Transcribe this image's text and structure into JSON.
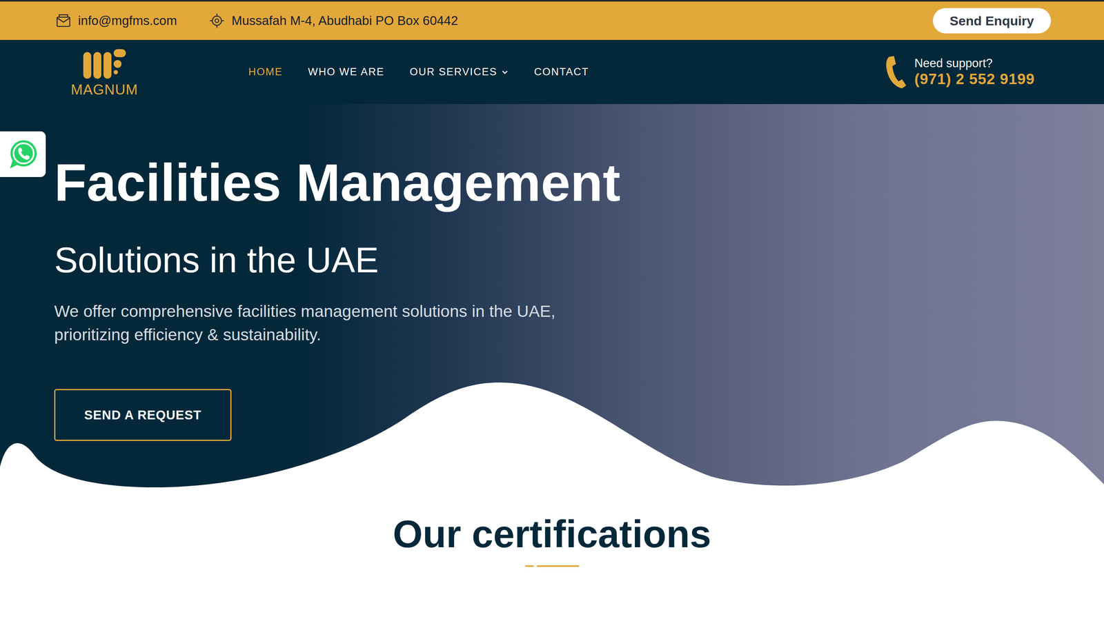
{
  "topbar": {
    "email": "info@mgfms.com",
    "address": "Mussafah M-4, Abudhabi PO Box 60442",
    "enquiry_button": "Send Enquiry"
  },
  "logo": {
    "text": "MAGNUM"
  },
  "nav": {
    "items": [
      {
        "label": "HOME",
        "selected": true,
        "dropdown": false
      },
      {
        "label": "WHO WE ARE",
        "selected": false,
        "dropdown": false
      },
      {
        "label": "OUR SERVICES",
        "selected": false,
        "dropdown": true
      },
      {
        "label": "CONTACT",
        "selected": false,
        "dropdown": false
      }
    ]
  },
  "support": {
    "label": "Need support?",
    "phone": "(971) 2 552 9199"
  },
  "hero": {
    "title": "Facilities Management",
    "subtitle": "Solutions in the UAE",
    "text": "We offer comprehensive facilities management solutions in the UAE, prioritizing efficiency & sustainability.",
    "button": "SEND A REQUEST"
  },
  "certifications": {
    "title": "Our certifications"
  }
}
